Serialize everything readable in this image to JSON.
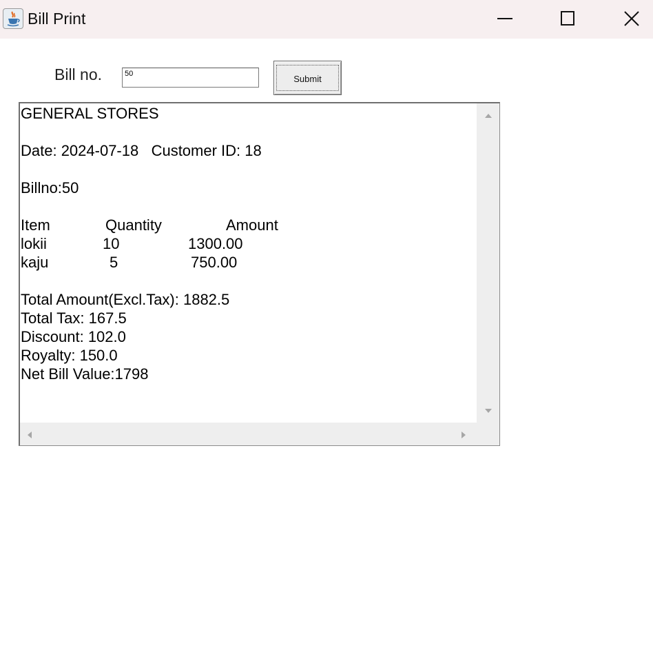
{
  "window": {
    "title": "Bill Print",
    "app_icon": "java-cup-icon",
    "controls": [
      "minimize-icon",
      "maximize-icon",
      "close-icon"
    ]
  },
  "form": {
    "bill_label": "Bill no.",
    "bill_value": "50",
    "submit_label": "Submit"
  },
  "bill": {
    "store_name": "GENERAL STORES",
    "date_line": "Date: 2024-07-18   Customer ID: 18",
    "bill_no_line": "Billno:50",
    "headers": {
      "item": "Item",
      "quantity": "Quantity",
      "amount": "Amount"
    },
    "items": [
      {
        "item": "lokii",
        "quantity": "10",
        "amount": "1300.00"
      },
      {
        "item": "kaju",
        "quantity": "5",
        "amount": "750.00"
      }
    ],
    "total_amount_line": "Total Amount(Excl.Tax): 1882.5",
    "total_tax_line": "Total Tax: 167.5",
    "discount_line": "Discount: 102.0",
    "royalty_line": "Royalty: 150.0",
    "net_bill_line": "Net Bill Value:1798"
  },
  "colors": {
    "titlebar": "#f7eff0",
    "scrollbar_track": "#eeeeee",
    "arrow": "#a6a6a6"
  }
}
